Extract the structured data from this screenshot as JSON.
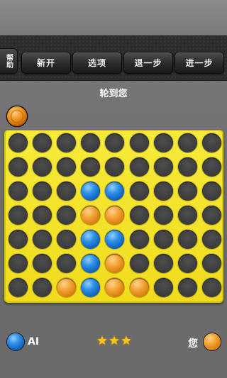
{
  "toolbar": {
    "help_label": "帮助",
    "buttons": [
      {
        "label": "新开"
      },
      {
        "label": "选项"
      },
      {
        "label": "退一步"
      },
      {
        "label": "进一步"
      }
    ]
  },
  "status": {
    "turn_text": "轮到您"
  },
  "board": {
    "columns": 9,
    "rows": 7,
    "cells": [
      [
        "",
        "",
        "",
        "",
        "",
        "",
        "",
        "",
        ""
      ],
      [
        "",
        "",
        "",
        "",
        "",
        "",
        "",
        "",
        ""
      ],
      [
        "",
        "",
        "",
        "blue",
        "blue",
        "",
        "",
        "",
        ""
      ],
      [
        "",
        "",
        "",
        "orange",
        "orange",
        "",
        "",
        "",
        ""
      ],
      [
        "",
        "",
        "",
        "blue",
        "blue",
        "",
        "",
        "",
        ""
      ],
      [
        "",
        "",
        "",
        "blue",
        "orange",
        "",
        "",
        "",
        ""
      ],
      [
        "",
        "",
        "orange",
        "blue",
        "orange",
        "orange",
        "",
        "",
        ""
      ]
    ],
    "next_piece": "orange"
  },
  "players": {
    "left": {
      "label": "AI",
      "color": "blue"
    },
    "right": {
      "label": "您",
      "color": "orange"
    }
  },
  "difficulty_stars": 3,
  "colors": {
    "board_yellow": "#f0dc1c",
    "piece_blue": "#1a73d1",
    "piece_orange": "#e88a1a",
    "star_gold": "#f5c226"
  }
}
